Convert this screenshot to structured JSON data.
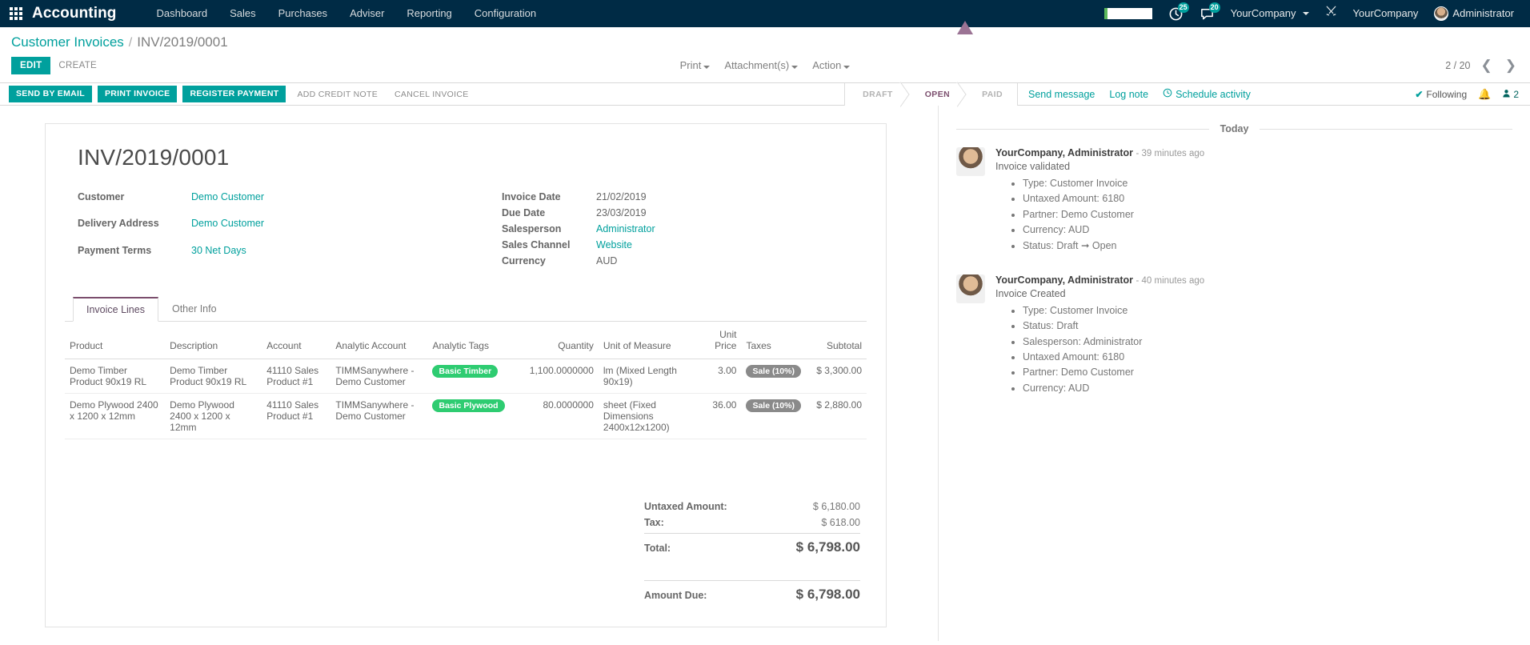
{
  "navbar": {
    "apps_icon": "apps-grid-icon",
    "brand": "Accounting",
    "menu": [
      "Dashboard",
      "Sales",
      "Purchases",
      "Adviser",
      "Reporting",
      "Configuration"
    ],
    "right": {
      "activity_badge": "25",
      "messages_badge": "20",
      "company_selector": "YourCompany",
      "debug_icon": "wrench-screwdriver-icon",
      "company_label": "YourCompany",
      "user_name": "Administrator"
    }
  },
  "breadcrumb": {
    "parent": "Customer Invoices",
    "separator": "/",
    "current": "INV/2019/0001"
  },
  "control_panel": {
    "edit": "EDIT",
    "create": "CREATE",
    "print": "Print",
    "attachments": "Attachment(s)",
    "action": "Action",
    "pager": "2 / 20",
    "prev_icon": "chevron-left-icon",
    "next_icon": "chevron-right-icon"
  },
  "action_bar": {
    "send_by_email": "SEND BY EMAIL",
    "print_invoice": "PRINT INVOICE",
    "register_payment": "REGISTER PAYMENT",
    "add_credit_note": "ADD CREDIT NOTE",
    "cancel_invoice": "CANCEL INVOICE",
    "status_steps": [
      "DRAFT",
      "OPEN",
      "PAID"
    ],
    "active_status": "OPEN"
  },
  "chatter_tools": {
    "send_message": "Send message",
    "log_note": "Log note",
    "schedule_activity": "Schedule activity",
    "schedule_icon": "clock-icon",
    "following": "Following",
    "check_icon": "check-icon",
    "bell_icon": "bell-icon",
    "followers_icon": "user-icon",
    "followers_count": "2"
  },
  "invoice": {
    "title": "INV/2019/0001",
    "left_fields": [
      {
        "label": "Customer",
        "value": "Demo Customer",
        "link": true
      },
      {
        "label": "Delivery Address",
        "value": "Demo Customer",
        "link": true
      },
      {
        "label": "Payment Terms",
        "value": "30 Net Days",
        "link": true
      }
    ],
    "right_fields": [
      {
        "label": "Invoice Date",
        "value": "21/02/2019",
        "link": false
      },
      {
        "label": "Due Date",
        "value": "23/03/2019",
        "link": false
      },
      {
        "label": "Salesperson",
        "value": "Administrator",
        "link": true
      },
      {
        "label": "Sales Channel",
        "value": "Website",
        "link": true
      },
      {
        "label": "Currency",
        "value": "AUD",
        "link": false
      }
    ],
    "tabs": [
      {
        "label": "Invoice Lines",
        "active": true
      },
      {
        "label": "Other Info",
        "active": false
      }
    ],
    "columns": [
      "Product",
      "Description",
      "Account",
      "Analytic Account",
      "Analytic Tags",
      "Quantity",
      "Unit of Measure",
      "Unit Price",
      "Taxes",
      "Subtotal"
    ],
    "rows": [
      {
        "product": "Demo Timber Product 90x19 RL",
        "description": "Demo Timber Product 90x19 RL",
        "account": "41110 Sales Product #1",
        "analytic_account": "TIMMSanywhere - Demo Customer",
        "analytic_tag": "Basic Timber",
        "quantity": "1,100.0000000",
        "uom": "lm (Mixed Length 90x19)",
        "unit_price": "3.00",
        "taxes": "Sale (10%)",
        "subtotal": "$ 3,300.00"
      },
      {
        "product": "Demo Plywood 2400 x 1200 x 12mm",
        "description": "Demo Plywood 2400 x 1200 x 12mm",
        "account": "41110 Sales Product #1",
        "analytic_account": "TIMMSanywhere - Demo Customer",
        "analytic_tag": "Basic Plywood",
        "quantity": "80.0000000",
        "uom": "sheet (Fixed Dimensions 2400x12x1200)",
        "unit_price": "36.00",
        "taxes": "Sale (10%)",
        "subtotal": "$ 2,880.00"
      }
    ],
    "totals": {
      "untaxed_label": "Untaxed Amount:",
      "untaxed_value": "$ 6,180.00",
      "tax_label": "Tax:",
      "tax_value": "$ 618.00",
      "total_label": "Total:",
      "total_value": "$ 6,798.00",
      "due_label": "Amount Due:",
      "due_value": "$ 6,798.00"
    }
  },
  "chatter": {
    "day_separator": "Today",
    "messages": [
      {
        "author": "YourCompany, Administrator",
        "time": "- 39 minutes ago",
        "subject": "Invoice validated",
        "details": [
          "Type: Customer Invoice",
          "Untaxed Amount: 6180",
          "Partner: Demo Customer",
          "Currency: AUD",
          "Status: Draft ➞ Open"
        ]
      },
      {
        "author": "YourCompany, Administrator",
        "time": "- 40 minutes ago",
        "subject": "Invoice Created",
        "details": [
          "Type: Customer Invoice",
          "Status: Draft",
          "Salesperson: Administrator",
          "Untaxed Amount: 6180",
          "Partner: Demo Customer",
          "Currency: AUD"
        ]
      }
    ]
  },
  "colors": {
    "navbar_bg": "#002b45",
    "accent": "#00a09d",
    "tag_green": "#2ecc71",
    "tax_gray": "#8a8a8a",
    "active_status": "#7b4e6d"
  }
}
